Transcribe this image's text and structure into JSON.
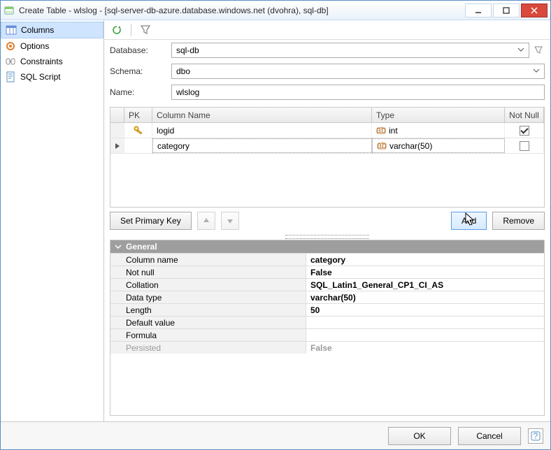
{
  "window": {
    "title": "Create Table - wlslog - [sql-server-db-azure.database.windows.net (dvohra), sql-db]"
  },
  "sidebar": {
    "items": [
      {
        "label": "Columns"
      },
      {
        "label": "Options"
      },
      {
        "label": "Constraints"
      },
      {
        "label": "SQL Script"
      }
    ]
  },
  "form": {
    "database_label": "Database:",
    "database_value": "sql-db",
    "schema_label": "Schema:",
    "schema_value": "dbo",
    "name_label": "Name:",
    "name_value": "wlslog"
  },
  "grid": {
    "headers": {
      "pk": "PK",
      "name": "Column Name",
      "type": "Type",
      "notnull": "Not Null"
    },
    "rows": [
      {
        "pk": true,
        "name": "logid",
        "type": "int",
        "notnull": true,
        "editing": false
      },
      {
        "pk": false,
        "name": "category",
        "type": "varchar(50)",
        "notnull": false,
        "editing": true
      }
    ]
  },
  "buttons": {
    "setpk": "Set Primary Key",
    "add": "Add",
    "remove": "Remove"
  },
  "props": {
    "section": "General",
    "rows": [
      {
        "label": "Column name",
        "value": "category"
      },
      {
        "label": "Not null",
        "value": "False"
      },
      {
        "label": "Collation",
        "value": "SQL_Latin1_General_CP1_CI_AS"
      },
      {
        "label": "Data type",
        "value": "varchar(50)"
      },
      {
        "label": "Length",
        "value": "50"
      },
      {
        "label": "Default value",
        "value": ""
      },
      {
        "label": "Formula",
        "value": ""
      },
      {
        "label": "Persisted",
        "value": "False",
        "dim": true
      }
    ]
  },
  "footer": {
    "ok": "OK",
    "cancel": "Cancel"
  }
}
